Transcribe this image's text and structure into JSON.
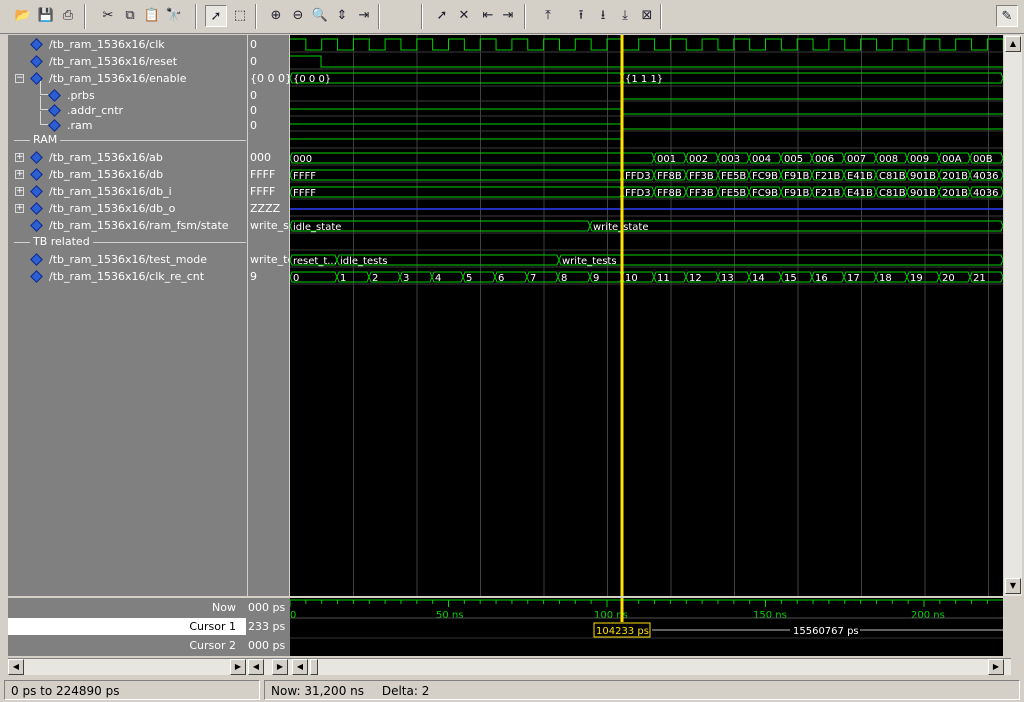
{
  "toolbar": {
    "buttons": [
      {
        "name": "open-icon",
        "glyph": "📂"
      },
      {
        "name": "save-icon",
        "glyph": "💾"
      },
      {
        "name": "print-icon",
        "glyph": "⎙"
      },
      {
        "name": "cut-icon",
        "glyph": "✂"
      },
      {
        "name": "copy-icon",
        "glyph": "⧉"
      },
      {
        "name": "paste-icon",
        "glyph": "📋"
      },
      {
        "name": "find-icon",
        "glyph": "🔭"
      },
      {
        "name": "select-mode-icon",
        "glyph": "➚"
      },
      {
        "name": "zoom-mode-icon",
        "glyph": "⬚"
      },
      {
        "name": "zoom-in-icon",
        "glyph": "⊕"
      },
      {
        "name": "zoom-out-icon",
        "glyph": "⊖"
      },
      {
        "name": "zoom-full-icon",
        "glyph": "🔍"
      },
      {
        "name": "zoom-cursor-icon",
        "glyph": "⇕"
      },
      {
        "name": "zoom-fit-icon",
        "glyph": "⇥"
      },
      {
        "name": "add-cursor-icon",
        "glyph": "➚"
      },
      {
        "name": "delete-cursor-icon",
        "glyph": "✕"
      },
      {
        "name": "prev-cursor-icon",
        "glyph": "⇤"
      },
      {
        "name": "next-cursor-icon",
        "glyph": "⇥"
      },
      {
        "name": "find-first-edge-icon",
        "glyph": "⤒"
      },
      {
        "name": "find-prev-edge-icon",
        "glyph": "⭱"
      },
      {
        "name": "find-next-edge-icon",
        "glyph": "⭳"
      },
      {
        "name": "find-last-edge-icon",
        "glyph": "⤓"
      },
      {
        "name": "clear-edges-icon",
        "glyph": "⊠"
      },
      {
        "name": "dock-icon",
        "glyph": "✎"
      }
    ]
  },
  "signals": [
    {
      "type": "signal",
      "name": "/tb_ram_1536x16/clk",
      "value": "0",
      "indent": 0,
      "expand": ""
    },
    {
      "type": "signal",
      "name": "/tb_ram_1536x16/reset",
      "value": "0",
      "indent": 0,
      "expand": ""
    },
    {
      "type": "signal",
      "name": "/tb_ram_1536x16/enable",
      "value": "{0 0 0}",
      "indent": 0,
      "expand": "−"
    },
    {
      "type": "signal",
      "name": ".prbs",
      "value": "0",
      "indent": 1,
      "expand": ""
    },
    {
      "type": "signal",
      "name": ".addr_cntr",
      "value": "0",
      "indent": 1,
      "expand": ""
    },
    {
      "type": "signal",
      "name": ".ram",
      "value": "0",
      "indent": 1,
      "expand": ""
    },
    {
      "type": "divider",
      "name": "RAM"
    },
    {
      "type": "signal",
      "name": "/tb_ram_1536x16/ab",
      "value": "000",
      "indent": 0,
      "expand": "+"
    },
    {
      "type": "signal",
      "name": "/tb_ram_1536x16/db",
      "value": "FFFF",
      "indent": 0,
      "expand": "+"
    },
    {
      "type": "signal",
      "name": "/tb_ram_1536x16/db_i",
      "value": "FFFF",
      "indent": 0,
      "expand": "+"
    },
    {
      "type": "signal",
      "name": "/tb_ram_1536x16/db_o",
      "value": "ZZZZ",
      "indent": 0,
      "expand": "+"
    },
    {
      "type": "signal",
      "name": "/tb_ram_1536x16/ram_fsm/state",
      "value": "write_st",
      "indent": 0,
      "expand": ""
    },
    {
      "type": "divider",
      "name": "TB related"
    },
    {
      "type": "signal",
      "name": "/tb_ram_1536x16/test_mode",
      "value": "write_te",
      "indent": 0,
      "expand": ""
    },
    {
      "type": "signal",
      "name": "/tb_ram_1536x16/clk_re_cnt",
      "value": "9",
      "indent": 0,
      "expand": ""
    }
  ],
  "waves": {
    "enable": [
      {
        "t": 0,
        "label": "{0 0 0}"
      },
      {
        "t": 332,
        "label": "{1 1 1}"
      }
    ],
    "ab": [
      {
        "t": 0,
        "label": "000"
      },
      {
        "t": 364,
        "label": "001"
      },
      {
        "t": 396,
        "label": "002"
      },
      {
        "t": 428,
        "label": "003"
      },
      {
        "t": 459,
        "label": "004"
      },
      {
        "t": 491,
        "label": "005"
      },
      {
        "t": 522,
        "label": "006"
      },
      {
        "t": 554,
        "label": "007"
      },
      {
        "t": 586,
        "label": "008"
      },
      {
        "t": 617,
        "label": "009"
      },
      {
        "t": 649,
        "label": "00A"
      },
      {
        "t": 680,
        "label": "00B"
      }
    ],
    "db": [
      {
        "t": 0,
        "label": "FFFF"
      },
      {
        "t": 332,
        "label": "FFD3"
      },
      {
        "t": 364,
        "label": "FF8B"
      },
      {
        "t": 396,
        "label": "FF3B"
      },
      {
        "t": 428,
        "label": "FE5B"
      },
      {
        "t": 459,
        "label": "FC9B"
      },
      {
        "t": 491,
        "label": "F91B"
      },
      {
        "t": 522,
        "label": "F21B"
      },
      {
        "t": 554,
        "label": "E41B"
      },
      {
        "t": 586,
        "label": "C81B"
      },
      {
        "t": 617,
        "label": "901B"
      },
      {
        "t": 649,
        "label": "201B"
      },
      {
        "t": 680,
        "label": "4036"
      }
    ],
    "db_i": [
      {
        "t": 0,
        "label": "FFFF"
      },
      {
        "t": 332,
        "label": "FFD3"
      },
      {
        "t": 364,
        "label": "FF8B"
      },
      {
        "t": 396,
        "label": "FF3B"
      },
      {
        "t": 428,
        "label": "FE5B"
      },
      {
        "t": 459,
        "label": "FC9B"
      },
      {
        "t": 491,
        "label": "F91B"
      },
      {
        "t": 522,
        "label": "F21B"
      },
      {
        "t": 554,
        "label": "E41B"
      },
      {
        "t": 586,
        "label": "C81B"
      },
      {
        "t": 617,
        "label": "901B"
      },
      {
        "t": 649,
        "label": "201B"
      },
      {
        "t": 680,
        "label": "4036"
      }
    ],
    "state": [
      {
        "t": 0,
        "label": "idle_state"
      },
      {
        "t": 300,
        "label": "write_state"
      }
    ],
    "test_mode": [
      {
        "t": 0,
        "label": "reset_t..."
      },
      {
        "t": 47,
        "label": "idle_tests"
      },
      {
        "t": 269,
        "label": "write_tests"
      }
    ],
    "clk_re_cnt": [
      {
        "t": 0,
        "label": "0"
      },
      {
        "t": 47,
        "label": "1"
      },
      {
        "t": 79,
        "label": "2"
      },
      {
        "t": 110,
        "label": "3"
      },
      {
        "t": 142,
        "label": "4"
      },
      {
        "t": 173,
        "label": "5"
      },
      {
        "t": 205,
        "label": "6"
      },
      {
        "t": 237,
        "label": "7"
      },
      {
        "t": 268,
        "label": "8"
      },
      {
        "t": 300,
        "label": "9"
      },
      {
        "t": 332,
        "label": "10"
      },
      {
        "t": 364,
        "label": "11"
      },
      {
        "t": 396,
        "label": "12"
      },
      {
        "t": 428,
        "label": "13"
      },
      {
        "t": 459,
        "label": "14"
      },
      {
        "t": 491,
        "label": "15"
      },
      {
        "t": 522,
        "label": "16"
      },
      {
        "t": 554,
        "label": "17"
      },
      {
        "t": 586,
        "label": "18"
      },
      {
        "t": 617,
        "label": "19"
      },
      {
        "t": 649,
        "label": "20"
      },
      {
        "t": 680,
        "label": "21"
      }
    ]
  },
  "timeline": {
    "now_label": "Now",
    "now_value": "000 ps",
    "cursor1_label": "Cursor 1",
    "cursor1_value": "233 ps",
    "cursor2_label": "Cursor 2",
    "cursor2_value": "000 ps",
    "ticks": [
      "0",
      "50 ns",
      "100 ns",
      "150 ns",
      "200 ns"
    ],
    "cursor1_time": "104233 ps",
    "cursor_delta": "15560767 ps"
  },
  "status": {
    "range": "0 ps to 224890 ps",
    "now": "Now: 31,200 ns",
    "delta": "Delta: 2"
  },
  "colors": {
    "wave": "#00d000",
    "cursor": "#ffe000",
    "z_bus": "#3040ff",
    "grid": "#404040"
  }
}
